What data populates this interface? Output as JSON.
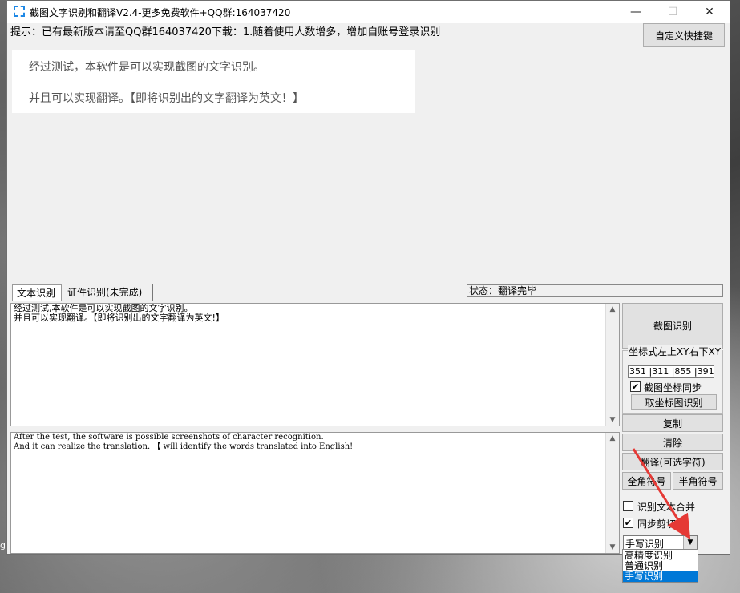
{
  "window": {
    "title": "截图文字识别和翻译V2.4-更多免费软件+QQ群:164037420",
    "minimize": "—",
    "maximize": "☐",
    "close": "✕"
  },
  "notice": "提示：已有最新版本请至QQ群164037420下载：1.随着使用人数增多，增加自账号登录识别",
  "shortcut_button": "自定义快捷键",
  "preview": {
    "line1": "经过测试，本软件是可以实现截图的文字识别。",
    "line2": "并且可以实现翻译。【即将识别出的文字翻译为英文！】"
  },
  "tabs": [
    {
      "label": "文本识别"
    },
    {
      "label": "证件识别(未完成)"
    }
  ],
  "status": "状态：翻译完毕",
  "recognized_text": "经过测试,本软件是可以实现截图的文字识别。\n并且可以实现翻译。【即将识别出的文字翻译为英文!】",
  "translated_text": "After the test, the software is possible screenshots of character recognition.\nAnd it can realize the translation. 【 will identify the words translated into English!",
  "buttons": {
    "capture": "截图识别",
    "coord_group_title": "坐标式左上XY右下XY",
    "coord_value": "351 |311 |855 |391",
    "sync_coord_label": "截图坐标同步",
    "coord_capture": "取坐标图识别",
    "copy": "复制",
    "clear": "清除",
    "translate": "翻译(可选字符)",
    "fullwidth": "全角符号",
    "halfwidth": "半角符号"
  },
  "options": {
    "merge_label": "识别文本合并",
    "merge_checked": false,
    "clipboard_label": "同步剪切板",
    "clipboard_checked": true
  },
  "mode_select": {
    "selected": "手写识别",
    "options": [
      "高精度识别",
      "普通识别",
      "手写识别"
    ]
  },
  "colors": {
    "accent": "#0078d7",
    "annotation_arrow": "#e53935"
  },
  "desktop_label": "ge"
}
